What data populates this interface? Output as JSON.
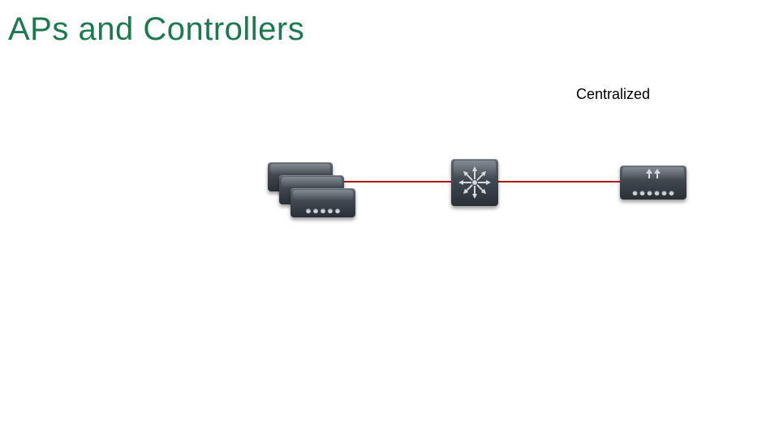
{
  "title": "APs and Controllers",
  "labels": {
    "mode": "Centralized"
  },
  "diagram": {
    "link_color": "#b01818",
    "nodes": {
      "switch_stack": {
        "count": 3,
        "icon": "switch"
      },
      "controller": {
        "icon": "wlan-controller"
      },
      "core": {
        "icon": "core-switch"
      }
    }
  }
}
